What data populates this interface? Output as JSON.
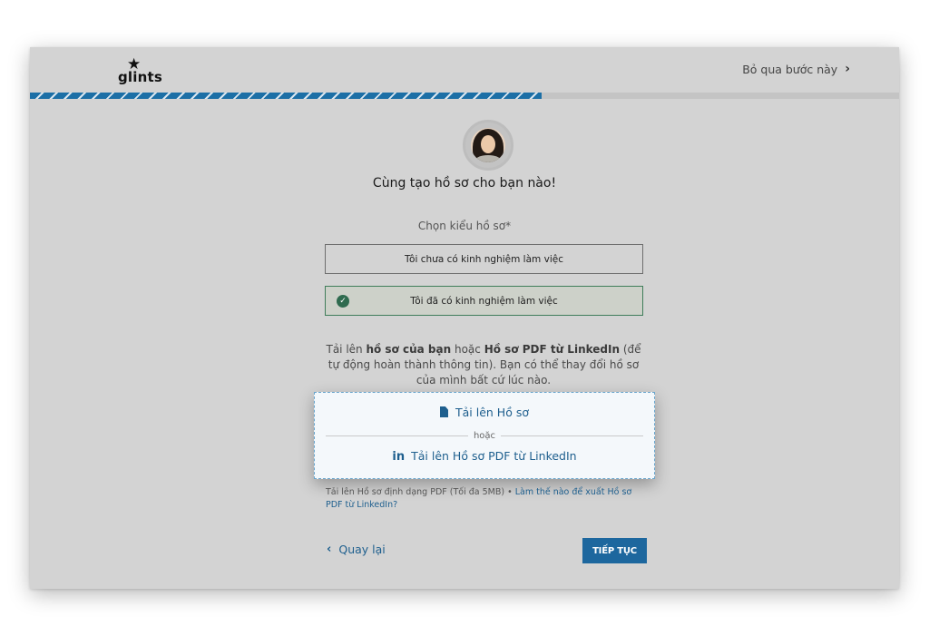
{
  "header": {
    "logo_text": "glints",
    "skip_label": "Bỏ qua bước này",
    "skip_icon": "chevron-right-icon"
  },
  "progress": {
    "value_percent": 58.9
  },
  "main": {
    "headline": "Cùng tạo hồ sơ cho bạn nào!",
    "profile_type_label": "Chọn kiểu hồ sơ*",
    "options": [
      {
        "label": "Tôi chưa có kinh nghiệm làm việc",
        "selected": false
      },
      {
        "label": "Tôi đã có kinh nghiệm làm việc",
        "selected": true
      }
    ],
    "description": {
      "part1": "Tải lên ",
      "bold1": "hồ sơ của bạn",
      "part2": " hoặc ",
      "bold2": "Hồ sơ PDF từ LinkedIn",
      "part3": " (để tự động hoàn thành thông tin). Bạn có thể thay đổi hồ sơ của mình bất cứ lúc nào."
    },
    "upload": {
      "resume_label": "Tải lên Hồ sơ",
      "or_label": "hoặc",
      "linkedin_icon_text": "in",
      "linkedin_label": "Tải lên Hồ sơ PDF từ LinkedIn"
    },
    "help": {
      "text": "Tải lên Hồ sơ định dạng PDF (Tối đa 5MB) • ",
      "link": "Làm thế nào để xuất Hồ sơ PDF từ LinkedIn?"
    }
  },
  "footer": {
    "back_label": "Quay lại",
    "next_label": "TIẾP TỤC"
  },
  "colors": {
    "accent": "#1d679e",
    "selected_border": "#3f7d5a",
    "check": "#2f6b4f",
    "frame_bg": "#d3d3d3"
  }
}
